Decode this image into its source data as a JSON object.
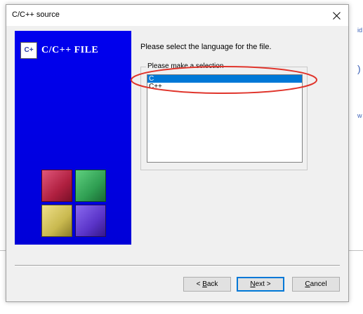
{
  "background_window": {
    "fragments": [
      "id",
      ")",
      "w"
    ]
  },
  "dialog": {
    "title": "C/C++ source",
    "close_glyph": "✕"
  },
  "sidebar": {
    "logo_text": "C/C++ FILE",
    "logo_icon_text": "C+"
  },
  "main": {
    "prompt": "Please select the language for the file.",
    "group_label": "Please make a selection",
    "options": [
      "C",
      "C++"
    ],
    "selected_index": 0
  },
  "buttons": {
    "back": {
      "prefix": "< ",
      "mnemonic": "B",
      "rest": "ack"
    },
    "next": {
      "mnemonic": "N",
      "rest": "ext >"
    },
    "cancel": {
      "mnemonic": "C",
      "rest": "ancel"
    }
  },
  "colors": {
    "sidebar_blue": "#0000ee",
    "selection": "#0078d7",
    "annotation_red": "#e0342b",
    "cube_red": "#c0304a",
    "cube_green": "#2f9e52",
    "cube_yellow": "#c9b94f",
    "cube_purple": "#5a34c8"
  },
  "icons": {
    "close": "close-icon",
    "logo": "codeblocks-logo-icon",
    "cubes": "codeblocks-cubes-icon"
  }
}
